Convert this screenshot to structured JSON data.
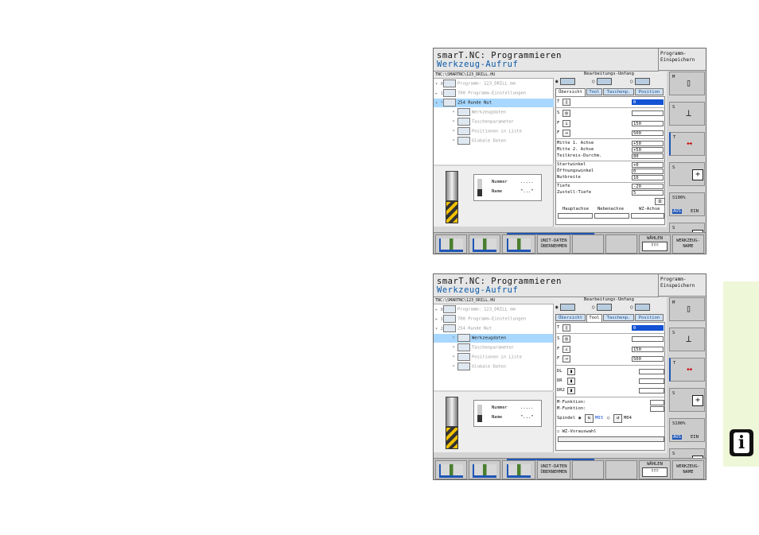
{
  "screen1": {
    "title_line1": "smarT.NC: Programmieren",
    "title_line2": "Werkzeug-Aufruf",
    "mode_label": "Programm-\nEinspeichern",
    "path": "TNC:\\SMARTNC\\123_DRILL.HU",
    "tree": [
      {
        "label": "Programm: 123_DRILL mm",
        "mark": "▾ 0"
      },
      {
        "label": "700 Programm-Einstellungen",
        "mark": "▸ 1"
      },
      {
        "label": "254 Runde Nut",
        "mark": "▾ *"
      },
      {
        "label": "Werkzeugdaten",
        "mark": "*"
      },
      {
        "label": "Taschenparameter",
        "mark": "*"
      },
      {
        "label": "Positionen in Liste",
        "mark": "*"
      },
      {
        "label": "Globale Daten",
        "mark": "*"
      }
    ],
    "preview": {
      "nummer_label": "Nummer",
      "nummer_value": ".....",
      "name_label": "Name",
      "name_value": "\"...\""
    },
    "bearb_label": "Bearbeitungs-Umfang",
    "tabs": [
      "Übersicht",
      "Tool",
      "Taschenp.",
      "Position"
    ],
    "rows": {
      "T": "0",
      "S": "",
      "F": "150",
      "F2": "500",
      "mitte1_label": "Mitte 1. Achse",
      "mitte1": "+50",
      "mitte2_label": "Mitte 2. Achse",
      "mitte2": "+50",
      "tk_label": "Teilkreis-Durchm.",
      "tk": "80",
      "start_label": "Startwinkel",
      "start": "+0",
      "oeff_label": "Öffnungswinkel",
      "oeff": "0",
      "nut_label": "Nutbreite",
      "nut": "10",
      "tiefe_label": "Tiefe",
      "tiefe": "-20",
      "zust_label": "Zustell-Tiefe",
      "zust": "5"
    },
    "axes": [
      "Hauptachse",
      "Nebenachse",
      "WZ-Achse"
    ],
    "softkeys": {
      "unit": "UNIT-DATEN\nÜBERNEHMEN",
      "waehlen": "WÄHLEN",
      "wz_name": "WERKZEUG-\nNAME"
    }
  },
  "screen2": {
    "title_line1": "smarT.NC: Programmieren",
    "title_line2": "Werkzeug-Aufruf",
    "mode_label": "Programm-\nEinspeichern",
    "path": "TNC:\\SMARTNC\\123_DRILL.HU",
    "tree": [
      {
        "label": "Programm: 123_DRILL mm",
        "mark": "▸ 0"
      },
      {
        "label": "700 Programm-Einstellungen",
        "mark": "▸ 1"
      },
      {
        "label": "254 Runde Nut",
        "mark": "▾ 2"
      },
      {
        "label": "Werkzeugdaten",
        "mark": "*"
      },
      {
        "label": "Taschenparameter",
        "mark": "*"
      },
      {
        "label": "Positionen in Liste",
        "mark": "*"
      },
      {
        "label": "Globale Daten",
        "mark": "*"
      }
    ],
    "preview": {
      "nummer_label": "Nummer",
      "nummer_value": ".....",
      "name_label": "Name",
      "name_value": "\"...\""
    },
    "bearb_label": "Bearbeitungs-Umfang",
    "tabs": [
      "Übersicht",
      "Tool",
      "Taschenp.",
      "Position"
    ],
    "rows": {
      "T": "0",
      "S": "",
      "F": "150",
      "F2": "500",
      "dl": "DL",
      "dr": "DR",
      "dr2": "DR2",
      "mfunk1": "M-Funktion:",
      "mfunk2": "M-Funktion:",
      "spindel": "Spindel",
      "m03": "M03",
      "m04": "M04",
      "vorauswahl": "WZ-Vorauswahl"
    },
    "softkeys": {
      "unit": "UNIT-DATEN\nÜBERNEHMEN",
      "waehlen": "WÄHLEN",
      "wz_name": "WERKZEUG-\nNAME"
    }
  },
  "vbar": {
    "s100": "S100%",
    "aus": "AUS",
    "ein": "EIN"
  },
  "colors": {
    "accent": "#1452d4",
    "title_blue": "#0b5aa8",
    "sidebar": "#eef7d8"
  },
  "icons": {
    "info": "info-icon"
  }
}
